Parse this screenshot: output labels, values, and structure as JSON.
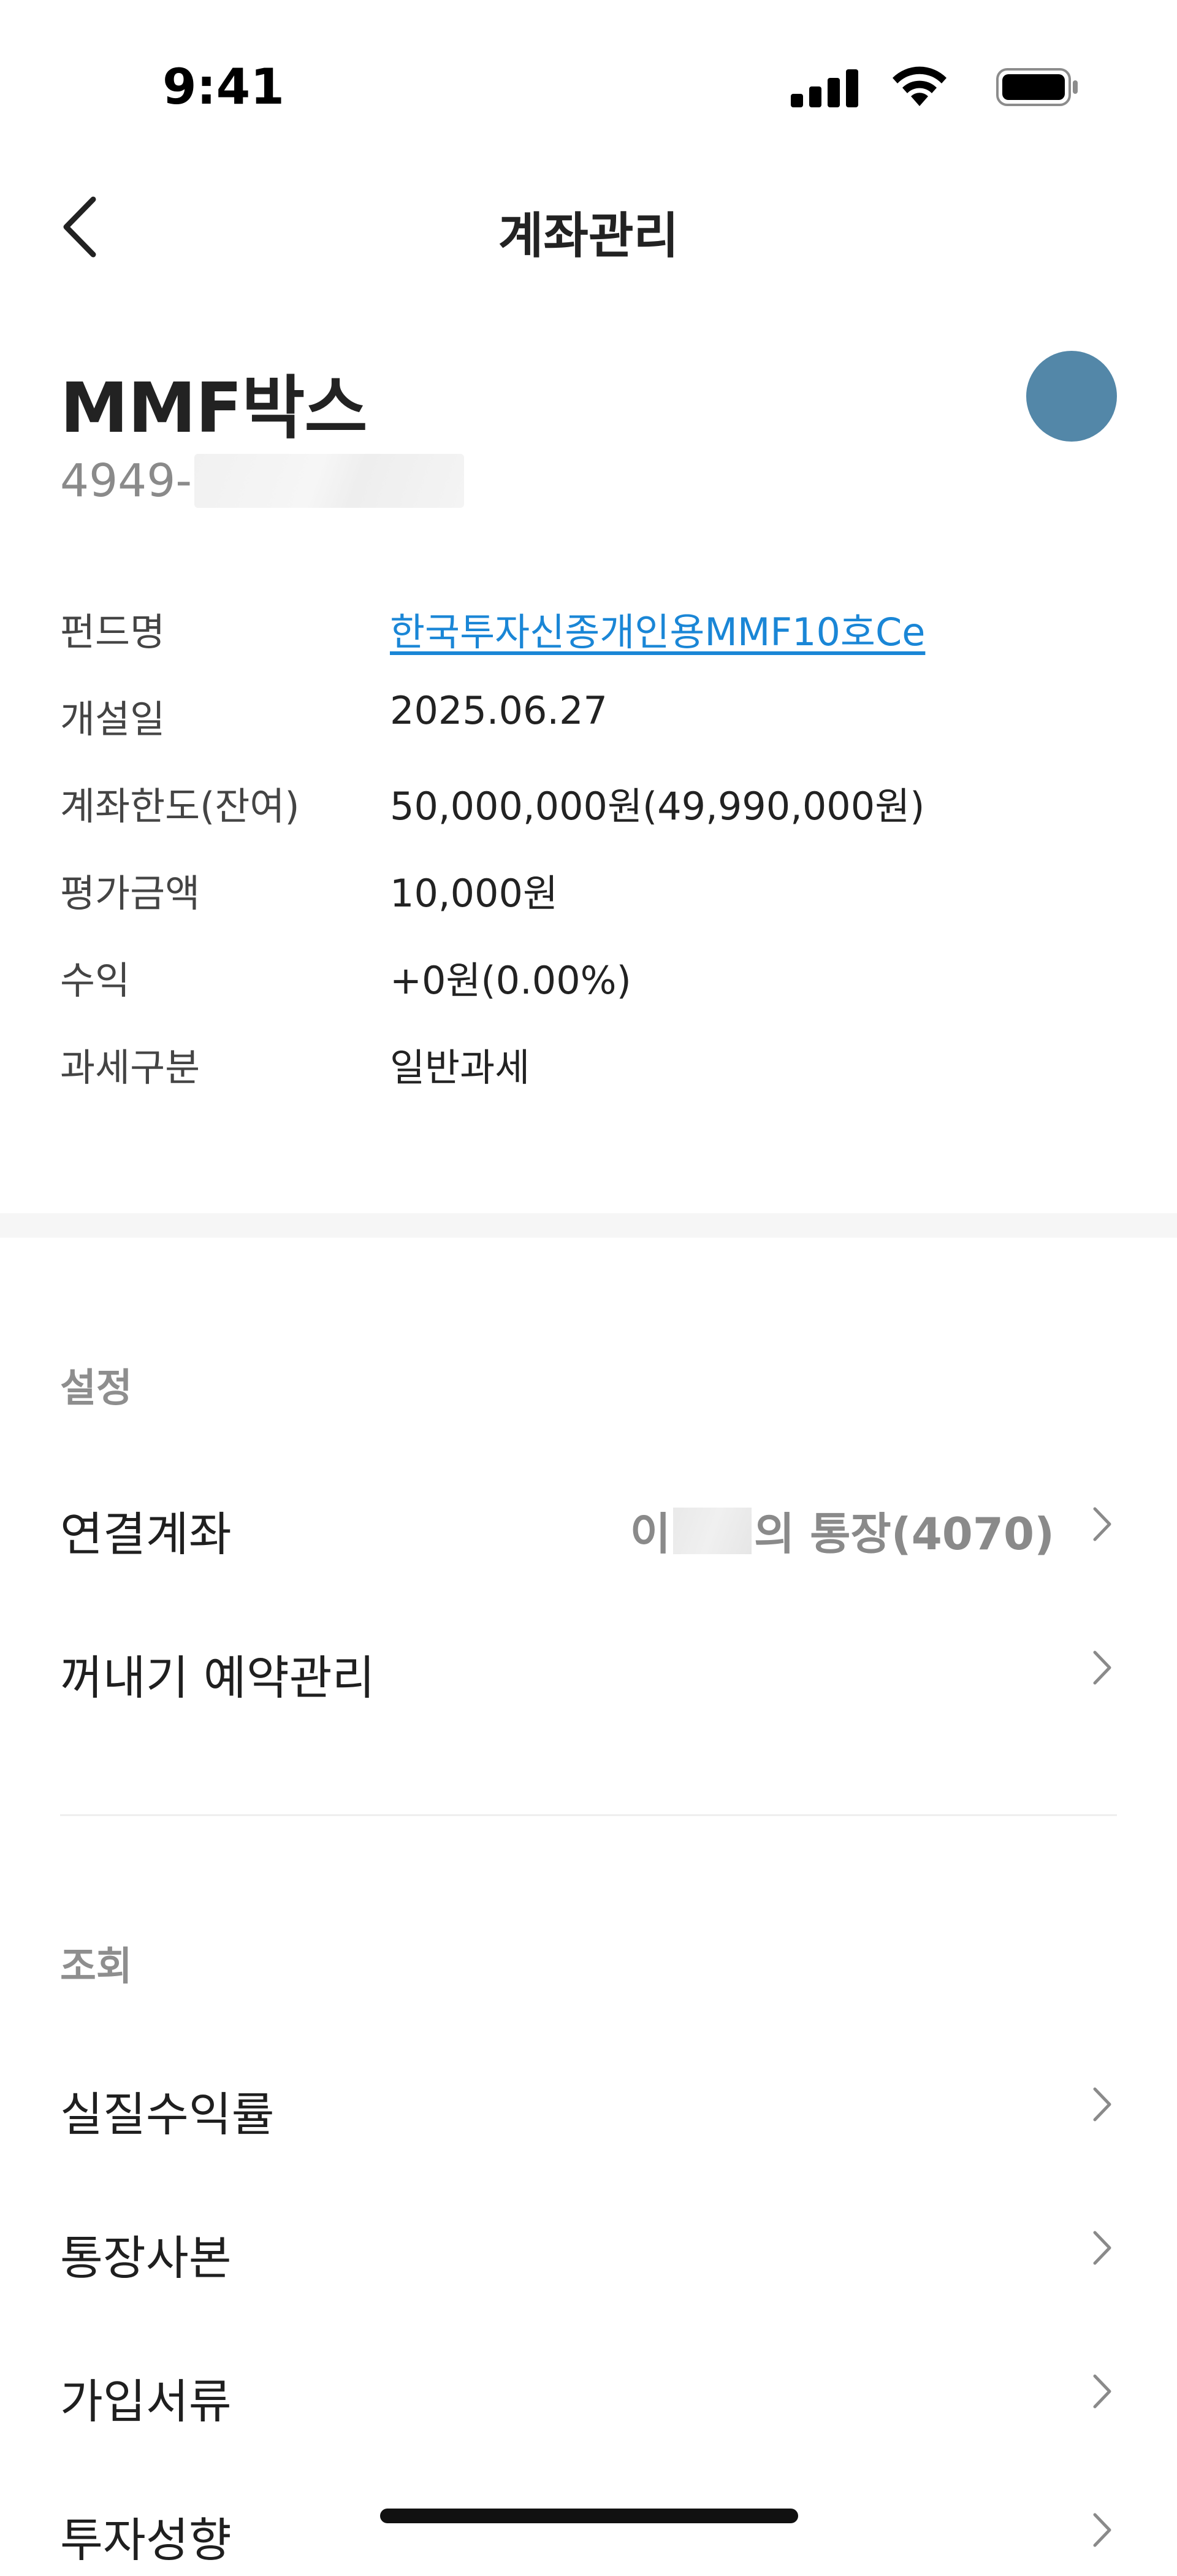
{
  "status_bar": {
    "time": "9:41"
  },
  "nav": {
    "title": "계좌관리"
  },
  "account": {
    "name": "MMF박스",
    "number_prefix": "4949-"
  },
  "info": {
    "rows": [
      {
        "label": "펀드명",
        "value": "한국투자신종개인용MMF10호Ce"
      },
      {
        "label": "개설일",
        "value": "2025.06.27"
      },
      {
        "label": "계좌한도(잔여)",
        "value": "50,000,000원(49,990,000원)"
      },
      {
        "label": "평가금액",
        "value": "10,000원"
      },
      {
        "label": "수익",
        "value": "+0원(0.00%)"
      },
      {
        "label": "과세구분",
        "value": "일반과세"
      }
    ]
  },
  "settings": {
    "header": "설정",
    "linked_account": {
      "label": "연결계좌",
      "detail_prefix": "이",
      "detail_suffix": "의 통장(4070)"
    },
    "withdraw_reservation": {
      "label": "꺼내기 예약관리"
    }
  },
  "inquiry": {
    "header": "조회",
    "items": [
      {
        "label": "실질수익률"
      },
      {
        "label": "통장사본"
      },
      {
        "label": "가입서류"
      },
      {
        "label": "투자성향"
      }
    ]
  },
  "colors": {
    "avatar": "#5387a8",
    "link": "#1a86d6",
    "section_header": "#8e8e8e"
  }
}
